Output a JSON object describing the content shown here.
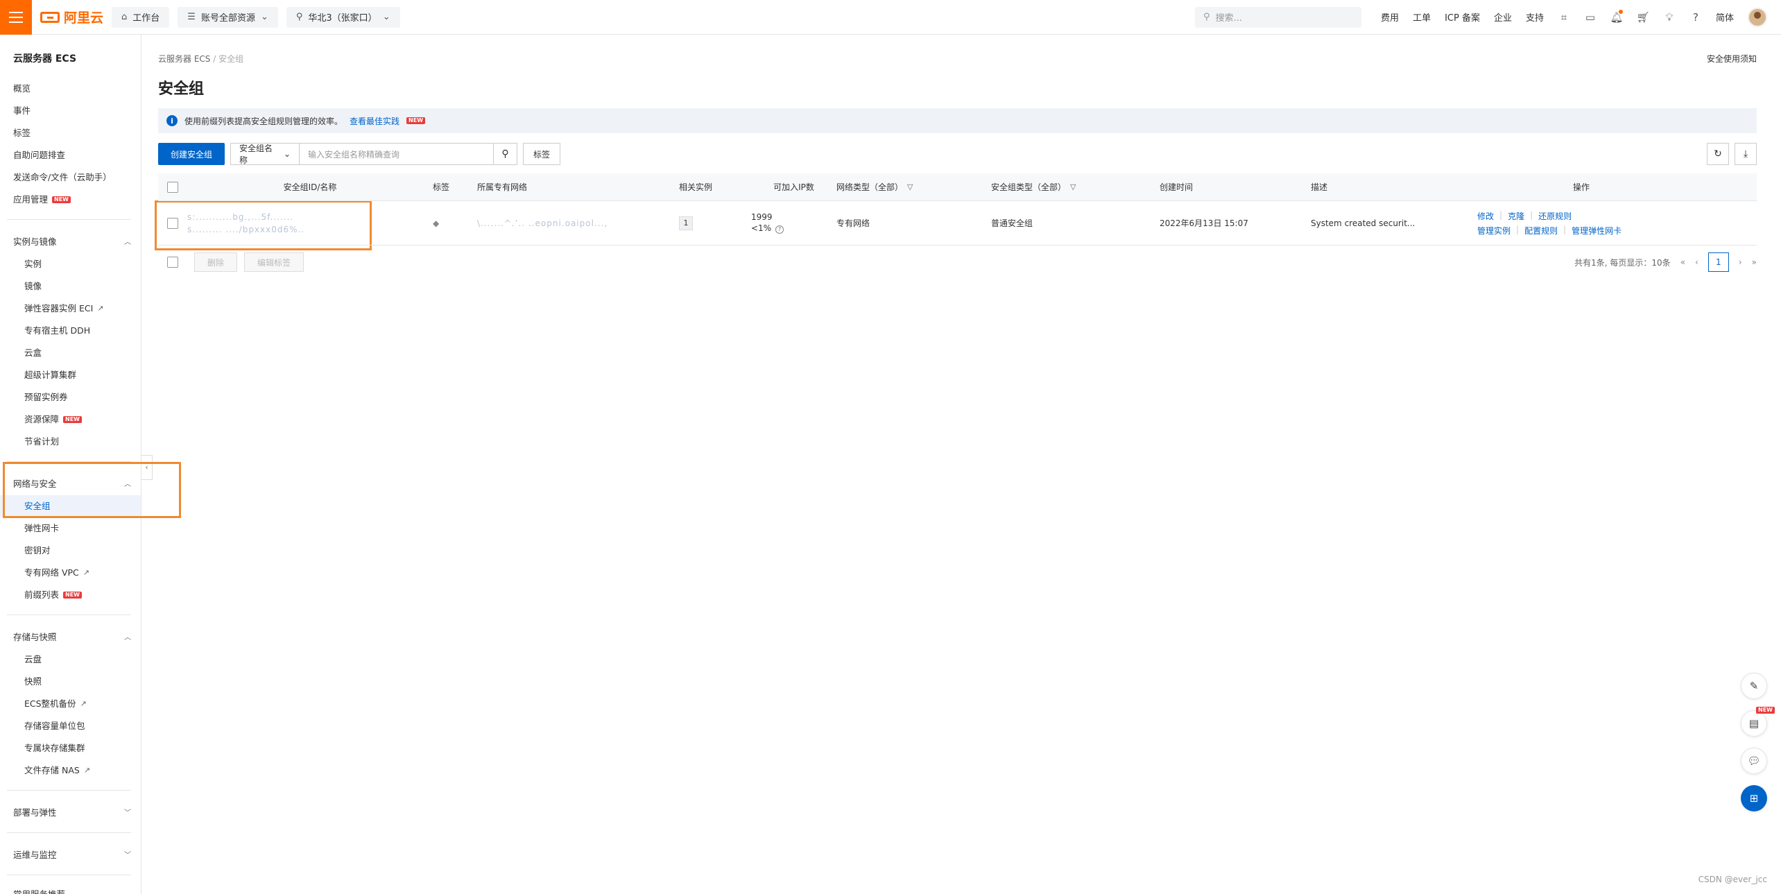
{
  "topbar": {
    "logo": "阿里云",
    "workbench": "工作台",
    "account_scope": "账号全部资源",
    "region": "华北3（张家口）",
    "search_placeholder": "搜索...",
    "links": [
      "费用",
      "工单",
      "ICP 备案",
      "企业",
      "支持"
    ],
    "lang": "简体"
  },
  "sidebar": {
    "title": "云服务器 ECS",
    "top_items": [
      "概览",
      "事件",
      "标签",
      "自助问题排查",
      "发送命令/文件（云助手）",
      "应用管理"
    ],
    "group_instances": {
      "label": "实例与镜像",
      "items": [
        "实例",
        "镜像",
        "弹性容器实例 ECI",
        "专有宿主机 DDH",
        "云盒",
        "超级计算集群",
        "预留实例券",
        "资源保障",
        "节省计划"
      ]
    },
    "group_network": {
      "label": "网络与安全",
      "items": [
        "安全组",
        "弹性网卡",
        "密钥对",
        "专有网络 VPC",
        "前缀列表"
      ]
    },
    "group_storage": {
      "label": "存储与快照",
      "items": [
        "云盘",
        "快照",
        "ECS整机备份",
        "存储容量单位包",
        "专属块存储集群",
        "文件存储 NAS"
      ]
    },
    "group_deploy": {
      "label": "部署与弹性"
    },
    "group_ops": {
      "label": "运维与监控"
    },
    "recommend": "常用服务推荐",
    "new_badge": "NEW"
  },
  "main": {
    "breadcrumb_root": "云服务器 ECS",
    "breadcrumb_sep": "/",
    "breadcrumb_current": "安全组",
    "help_link": "安全使用须知",
    "title": "安全组",
    "notice_text": "使用前缀列表提高安全组规则管理的效率。",
    "notice_link": "查看最佳实践",
    "create_button": "创建安全组",
    "filter_field": "安全组名称",
    "filter_placeholder": "输入安全组名称精确查询",
    "tag_button": "标签",
    "columns": {
      "id_name": "安全组ID/名称",
      "tag": "标签",
      "vpc": "所属专有网络",
      "instances": "相关实例",
      "ip_count": "可加入IP数",
      "network_type": "网络类型（全部）",
      "sg_type": "安全组类型（全部）",
      "created": "创建时间",
      "desc": "描述",
      "ops": "操作"
    },
    "row": {
      "id_line1": "s:...........bg.,...5f.......",
      "id_line2": "s......... ..../bpxxx0d6%..",
      "vpc": "\\.......^.’.. ..eopni.oaipol...,",
      "instances": "1",
      "ip_count": "1999",
      "ip_usage": "<1%",
      "network_type": "专有网络",
      "sg_type": "普通安全组",
      "created": "2022年6月13日 15:07",
      "desc": "System created securit...",
      "ops_line1": [
        "修改",
        "克隆",
        "还原规则"
      ],
      "ops_line2": [
        "管理实例",
        "配置规则",
        "管理弹性网卡"
      ]
    },
    "delete_button": "删除",
    "edit_tag_button": "编辑标签",
    "pager_summary": "共有1条, 每页显示：10条",
    "pager_current": "1"
  },
  "watermark": "CSDN @ever_jcc",
  "colors": {
    "brand": "#ff6a00",
    "primary": "#0064c8",
    "highlight": "#f08a30"
  }
}
